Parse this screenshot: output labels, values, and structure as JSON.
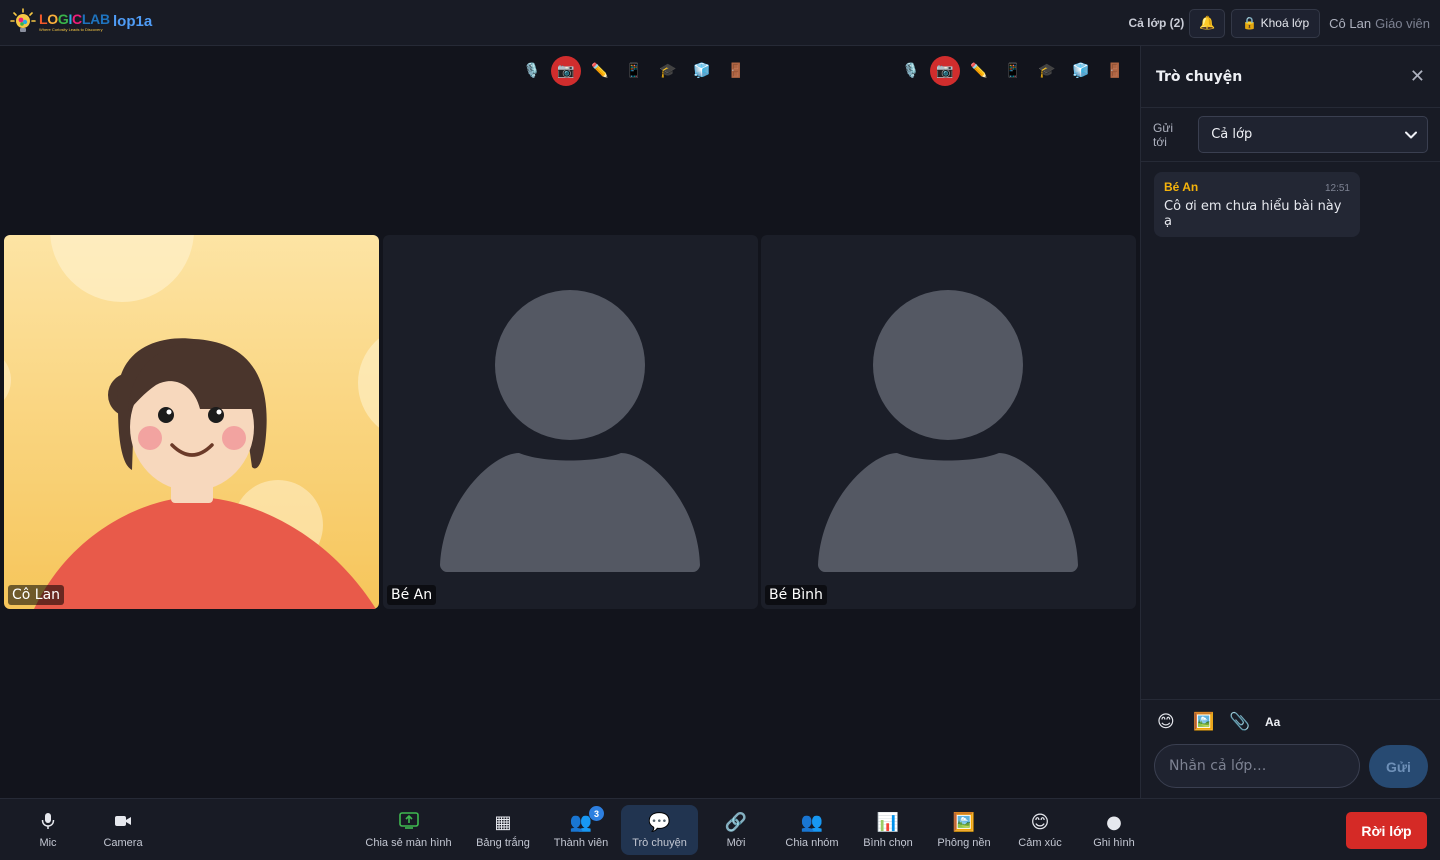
{
  "header": {
    "logo_word": [
      "L",
      "O",
      "G",
      "I",
      "C",
      "L",
      "A",
      "B"
    ],
    "logo_tagline": "Where Curiosity Leads to Discovery",
    "room_name": "lop1a",
    "class_count": "Cả lớp (2)",
    "bell_icon": "🔔",
    "lock_label": "🔒 Khoá lớp",
    "user_name": "Cô Lan",
    "user_role": "Giáo viên"
  },
  "tile_toolbar": {
    "icons": [
      "🎙️",
      "📷",
      "✏️",
      "📱",
      "🎓",
      "🧊",
      "🚪"
    ]
  },
  "participants": [
    {
      "name": "Cô Lan"
    },
    {
      "name": "Bé An"
    },
    {
      "name": "Bé Bình"
    }
  ],
  "chat": {
    "title": "Trò chuyện",
    "close_icon": "✕",
    "send_to_label": "Gửi tới",
    "send_to_value": "Cả lớp",
    "messages": [
      {
        "author": "Bé An",
        "time": "12:51",
        "text": "Cô ơi em chưa hiểu bài này ạ"
      }
    ],
    "tools": [
      "😊",
      "🖼️",
      "📎",
      "Aa"
    ],
    "input_placeholder": "Nhắn cả lớp…",
    "send_label": "Gửi"
  },
  "bottom_bar": {
    "mic": "Mic",
    "camera": "Camera",
    "items": [
      {
        "icon": "⬆",
        "label": "Chia sẻ màn hình"
      },
      {
        "icon": "▦",
        "label": "Bảng trắng"
      },
      {
        "icon": "👥",
        "label": "Thành viên",
        "badge": "3"
      },
      {
        "icon": "💬",
        "label": "Trò chuyện"
      },
      {
        "icon": "🔗",
        "label": "Mời"
      },
      {
        "icon": "👥",
        "label": "Chia nhóm"
      },
      {
        "icon": "📊",
        "label": "Bình chọn"
      },
      {
        "icon": "🖼️",
        "label": "Phông nền"
      },
      {
        "icon": "😊",
        "label": "Cảm xúc"
      },
      {
        "icon": "●",
        "label": "Ghi hình"
      }
    ],
    "leave_label": "Rời lớp"
  },
  "colors": {
    "accent": "#4f9cf6",
    "danger": "#d52a26",
    "author": "#f5b30b"
  }
}
